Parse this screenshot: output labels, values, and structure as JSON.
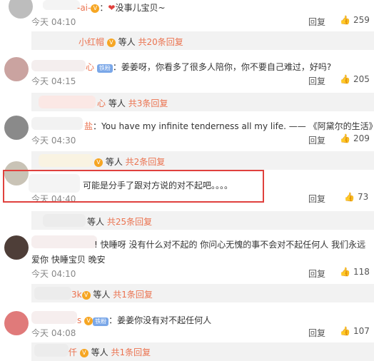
{
  "comments": [
    {
      "name": "-ai-",
      "text": "没事儿宝贝~",
      "time": "今天 04:10",
      "likes": "259"
    },
    {
      "name": "心",
      "text": "姜姜呀，你看多了很多人陪你，你不要自己难过，好吗?",
      "time": "今天 04:15",
      "likes": "205",
      "badge": "铁粉"
    },
    {
      "name": "盐",
      "text": "You have my infinite tenderness all my life. —— 《阿黛尔的生活》",
      "time": "今天 04:30",
      "likes": "209"
    },
    {
      "name": "",
      "text": "可能是分手了跟对方说的对不起吧。。。。",
      "time": "今天 04:40",
      "likes": "73"
    },
    {
      "name": "",
      "text": "!  快睡呀  没有什么对不起的  你问心无愧的事不会对不起任何人  我们永远",
      "text2": "爱你  快睡宝贝  晚安",
      "time": "今天 04:10",
      "likes": "118"
    },
    {
      "name": "s",
      "text": "姜姜你没有对不起任何人",
      "time": "今天 04:08",
      "likes": "107",
      "badge": "铁粉"
    }
  ],
  "subreplies": [
    {
      "name": "小红帽",
      "suffix": "等人",
      "count": "共20条回复"
    },
    {
      "name": "心",
      "suffix": "等人",
      "count": "共3条回复"
    },
    {
      "name": "",
      "suffix": "等人",
      "count": "共2条回复"
    },
    {
      "name": "等人",
      "suffix": "",
      "count": "共25条回复"
    },
    {
      "name": "3k",
      "suffix": "等人",
      "count": "共1条回复"
    },
    {
      "name": "仟",
      "suffix": "等人",
      "count": "共1条回复"
    }
  ],
  "labels": {
    "reply": "回复",
    "heart": "❤",
    "thumb": "👍"
  },
  "colors": {
    "accent": "#eb7350",
    "highlight": "#e0413d"
  }
}
